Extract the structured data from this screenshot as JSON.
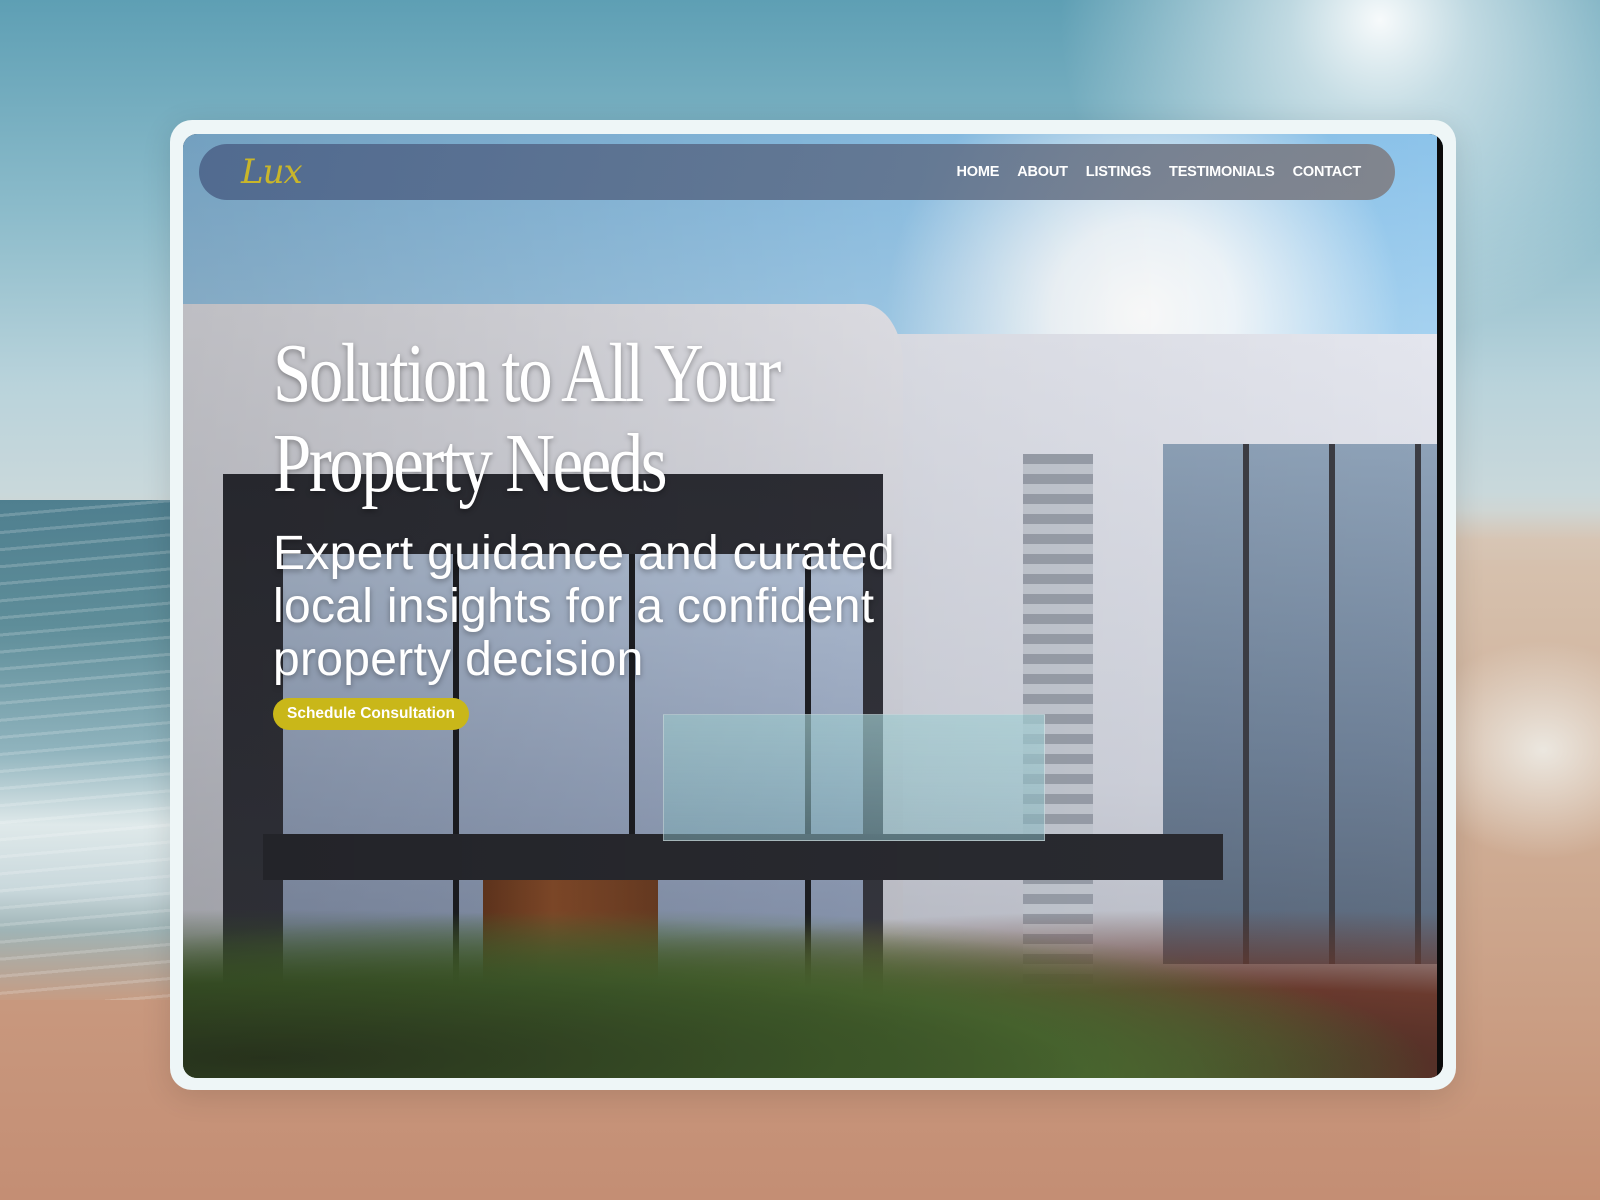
{
  "brand": {
    "logo_text": "Lux",
    "logo_color": "#c9b62a"
  },
  "nav": {
    "items": [
      {
        "label": "HOME"
      },
      {
        "label": "ABOUT"
      },
      {
        "label": "LISTINGS"
      },
      {
        "label": "TESTIMONIALS"
      },
      {
        "label": "CONTACT"
      }
    ]
  },
  "hero": {
    "headline_line1": "Solution to All Your",
    "headline_line2": "Property Needs",
    "subhead": "Expert guidance and curated local insights for a confident property decision",
    "cta_label": "Schedule Consultation",
    "cta_color": "#c9b719"
  }
}
